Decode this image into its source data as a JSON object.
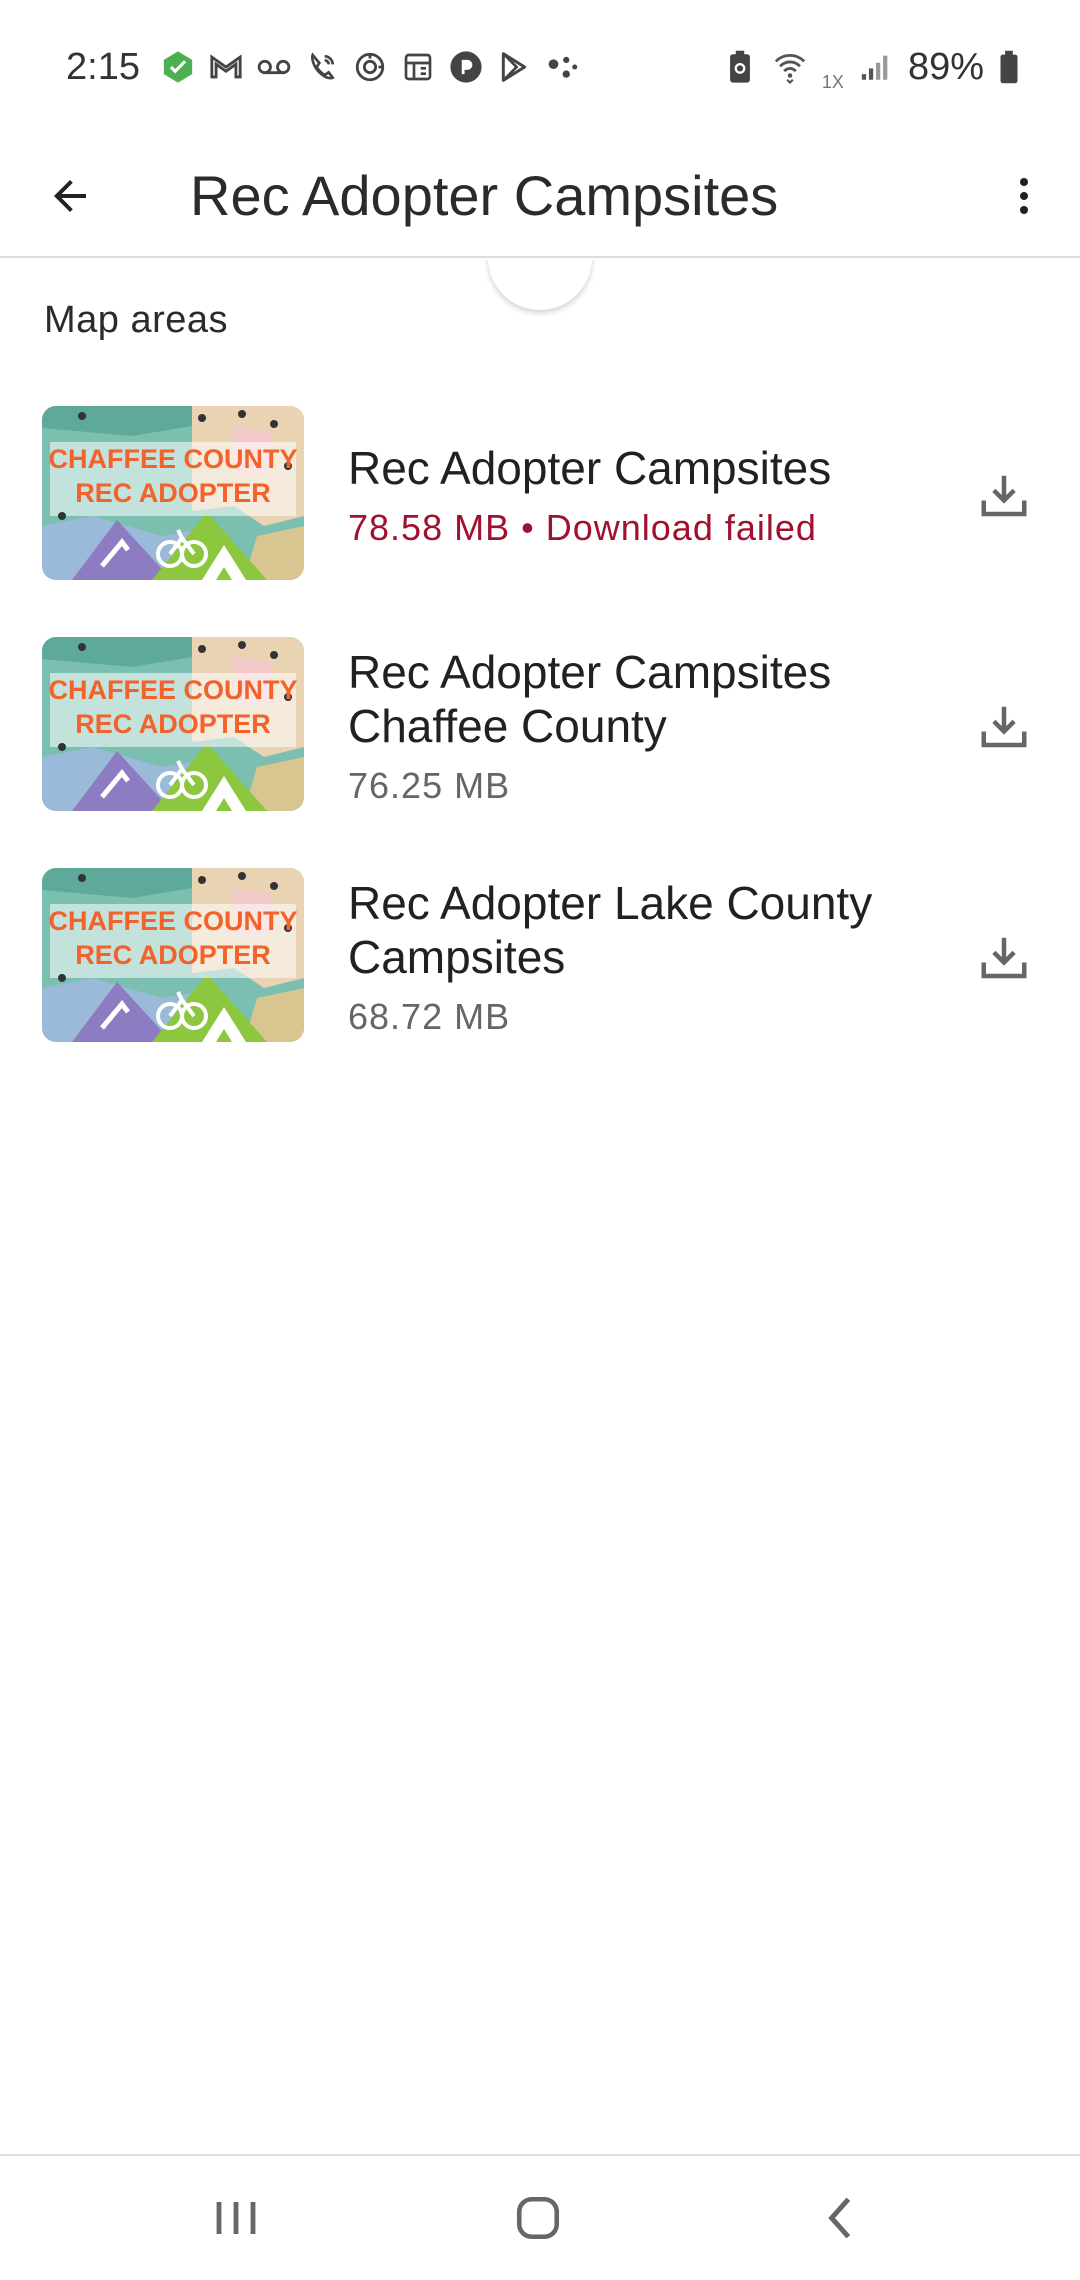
{
  "status_bar": {
    "time": "2:15",
    "battery_percent": "89%",
    "network_label": "1X",
    "icons": [
      "list-check-icon",
      "gmail-icon",
      "voicemail-icon",
      "wifi-calling-icon",
      "sync-icon",
      "calendar-icon",
      "pocket-casts-icon",
      "play-store-icon",
      "assistant-icon",
      "battery-saver-icon",
      "wifi-icon",
      "signal-icon",
      "battery-icon"
    ]
  },
  "app_bar": {
    "title": "Rec Adopter Campsites",
    "back_icon": "arrow-back-icon",
    "overflow_icon": "more-vert-icon"
  },
  "section": {
    "title": "Map areas"
  },
  "map_areas": [
    {
      "title": "Rec Adopter Campsites",
      "size": "78.58 MB",
      "separator": "•",
      "status": "Download failed",
      "thumbnail_line1": "CHAFFEE COUNTY",
      "thumbnail_line2": "REC ADOPTER"
    },
    {
      "title": "Rec Adopter Campsites Chaffee County",
      "size": "76.25 MB",
      "thumbnail_line1": "CHAFFEE COUNTY",
      "thumbnail_line2": "REC ADOPTER"
    },
    {
      "title": "Rec Adopter Lake County Campsites",
      "size": "68.72 MB",
      "thumbnail_line1": "CHAFFEE COUNTY",
      "thumbnail_line2": "REC ADOPTER"
    }
  ],
  "colors": {
    "error": "#a0112e",
    "secondary_text": "#666666",
    "primary_text": "#202124",
    "thumb_orange": "#f2622a",
    "thumb_teal": "#6ab5a6",
    "thumb_green": "#8dc63f",
    "thumb_purple": "#8e7cc3"
  },
  "nav_bar": {
    "recents_icon": "recents-icon",
    "home_icon": "home-icon",
    "back_icon": "nav-back-icon"
  }
}
